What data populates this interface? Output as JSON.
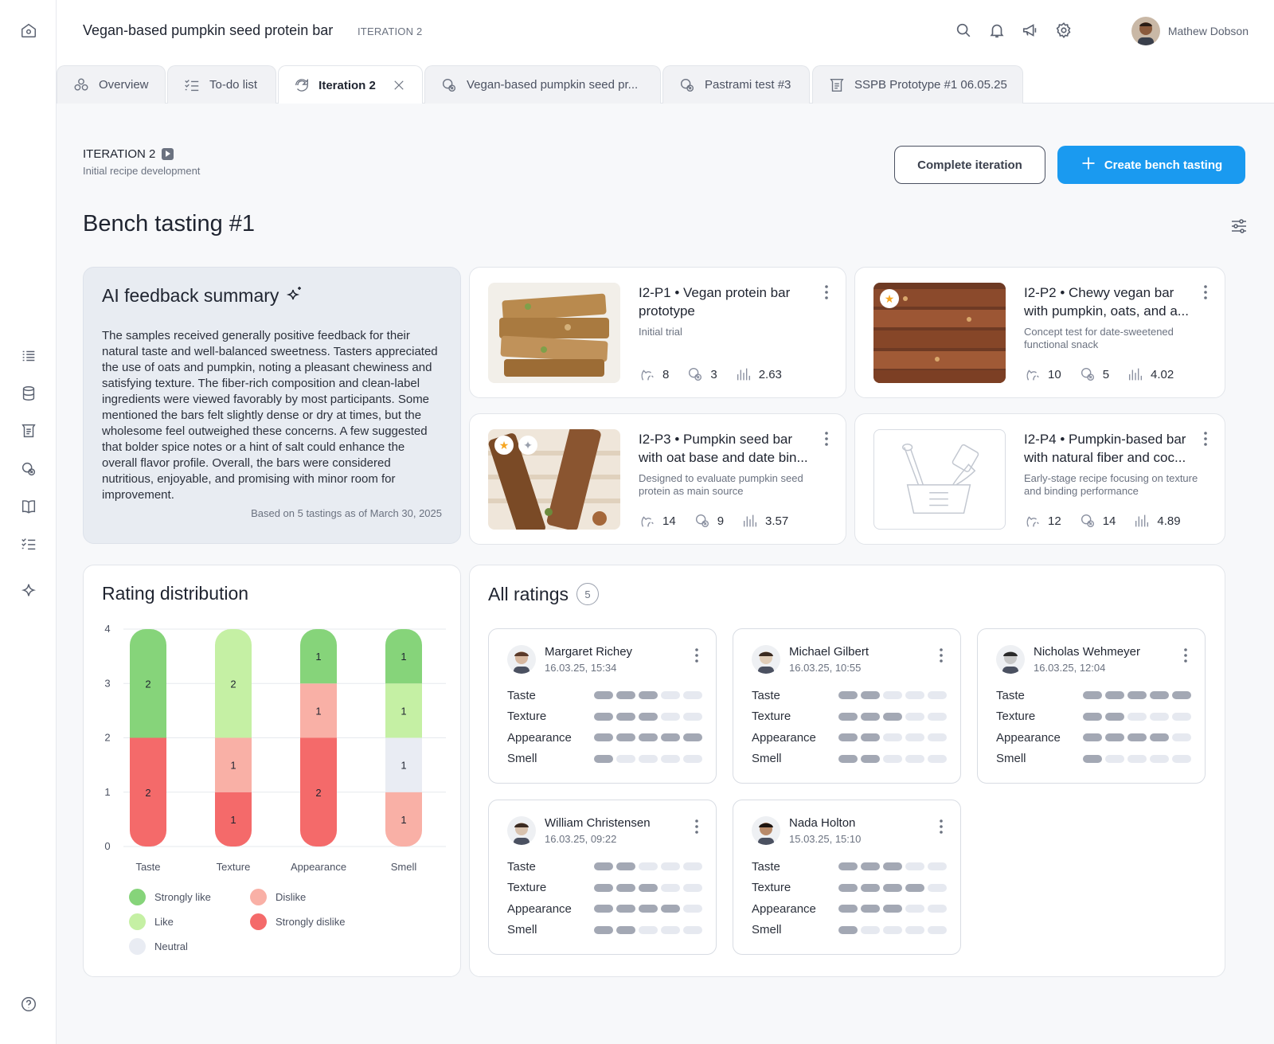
{
  "header": {
    "title": "Vegan-based pumpkin seed protein bar",
    "iteration_tag": "ITERATION 2",
    "user_name": "Mathew Dobson"
  },
  "tabs": [
    {
      "label": "Overview",
      "icon": "flask-icon"
    },
    {
      "label": "To-do list",
      "icon": "checklist-icon"
    },
    {
      "label": "Iteration 2",
      "icon": "iteration-icon",
      "active": true
    },
    {
      "label": "Vegan-based pumpkin seed pr...",
      "icon": "tasting-icon"
    },
    {
      "label": "Pastrami test #3",
      "icon": "tasting-icon"
    },
    {
      "label": "SSPB Prototype #1 06.05.25",
      "icon": "recipe-icon"
    }
  ],
  "iteration": {
    "label": "ITERATION 2",
    "subtitle": "Initial recipe development"
  },
  "buttons": {
    "complete": "Complete iteration",
    "create": "Create bench tasting"
  },
  "page_title": "Bench tasting #1",
  "ai_summary": {
    "title": "AI feedback summary",
    "text": "The samples received generally positive feedback for their natural taste and well-balanced sweetness. Tasters appreciated the use of oats and pumpkin, noting a pleasant chewiness and satisfying texture. The fiber-rich composition and clean-label ingredients were viewed favorably by most participants. Some mentioned the bars felt slightly dense or dry at times, but the wholesome feel outweighed these concerns. A few suggested that bolder spice notes or a hint of salt could enhance the overall flavor profile. Overall, the bars were considered nutritious, enjoyable, and promising with minor room for improvement.",
    "based_on": "Based on 5 tastings as of March 30, 2025"
  },
  "products": [
    {
      "title": "I2-P1 • Vegan protein bar prototype",
      "desc": "Initial trial",
      "tastings": "8",
      "rejected": "3",
      "score": "2.63",
      "starred": false
    },
    {
      "title": "I2-P2 • Chewy vegan bar with pumpkin, oats, and a...",
      "desc": "Concept test for date-sweetened functional snack",
      "tastings": "10",
      "rejected": "5",
      "score": "4.02",
      "starred": true
    },
    {
      "title": "I2-P3 • Pumpkin seed bar with oat base and date bin...",
      "desc": "Designed to evaluate pumpkin seed protein as main source",
      "tastings": "14",
      "rejected": "9",
      "score": "3.57",
      "starred": true
    },
    {
      "title": "I2-P4 • Pumpkin-based bar with natural fiber and coc...",
      "desc": "Early-stage recipe focusing on texture and binding performance",
      "tastings": "12",
      "rejected": "14",
      "score": "4.89",
      "starred": false
    }
  ],
  "distribution_title": "Rating distribution",
  "chart_data": {
    "type": "bar",
    "stacked": true,
    "categories": [
      "Taste",
      "Texture",
      "Appearance",
      "Smell"
    ],
    "ylim": [
      0,
      4
    ],
    "yticks": [
      0,
      1,
      2,
      3,
      4
    ],
    "grid": true,
    "series": [
      {
        "name": "Strongly dislike",
        "color": "#f46a6a",
        "values": [
          2,
          1,
          2,
          0
        ]
      },
      {
        "name": "Dislike",
        "color": "#f9b0a6",
        "values": [
          0,
          1,
          1,
          1
        ]
      },
      {
        "name": "Neutral",
        "color": "#e9ecf3",
        "values": [
          0,
          0,
          0,
          1
        ]
      },
      {
        "name": "Like",
        "color": "#c5f0a4",
        "values": [
          0,
          2,
          0,
          1
        ]
      },
      {
        "name": "Strongly like",
        "color": "#86d47a",
        "values": [
          2,
          0,
          1,
          1
        ]
      }
    ]
  },
  "legend": [
    {
      "label": "Strongly like",
      "color": "#86d47a"
    },
    {
      "label": "Dislike",
      "color": "#f9b0a6"
    },
    {
      "label": "Like",
      "color": "#c5f0a4"
    },
    {
      "label": "Strongly dislike",
      "color": "#f46a6a"
    },
    {
      "label": "Neutral",
      "color": "#e9ecf3"
    }
  ],
  "all_ratings": {
    "title": "All ratings",
    "count": "5",
    "criteria": [
      "Taste",
      "Texture",
      "Appearance",
      "Smell"
    ],
    "ratings": [
      {
        "name": "Margaret Richey",
        "date": "16.03.25, 15:34",
        "scores": [
          3,
          3,
          5,
          1
        ]
      },
      {
        "name": "Michael Gilbert",
        "date": "16.03.25, 10:55",
        "scores": [
          2,
          3,
          2,
          2
        ]
      },
      {
        "name": "Nicholas Wehmeyer",
        "date": "16.03.25, 12:04",
        "scores": [
          5,
          2,
          4,
          1
        ]
      },
      {
        "name": "William Christensen",
        "date": "16.03.25, 09:22",
        "scores": [
          2,
          3,
          4,
          2
        ]
      },
      {
        "name": "Nada Holton",
        "date": "15.03.25, 15:10",
        "scores": [
          3,
          4,
          3,
          1
        ]
      }
    ]
  }
}
